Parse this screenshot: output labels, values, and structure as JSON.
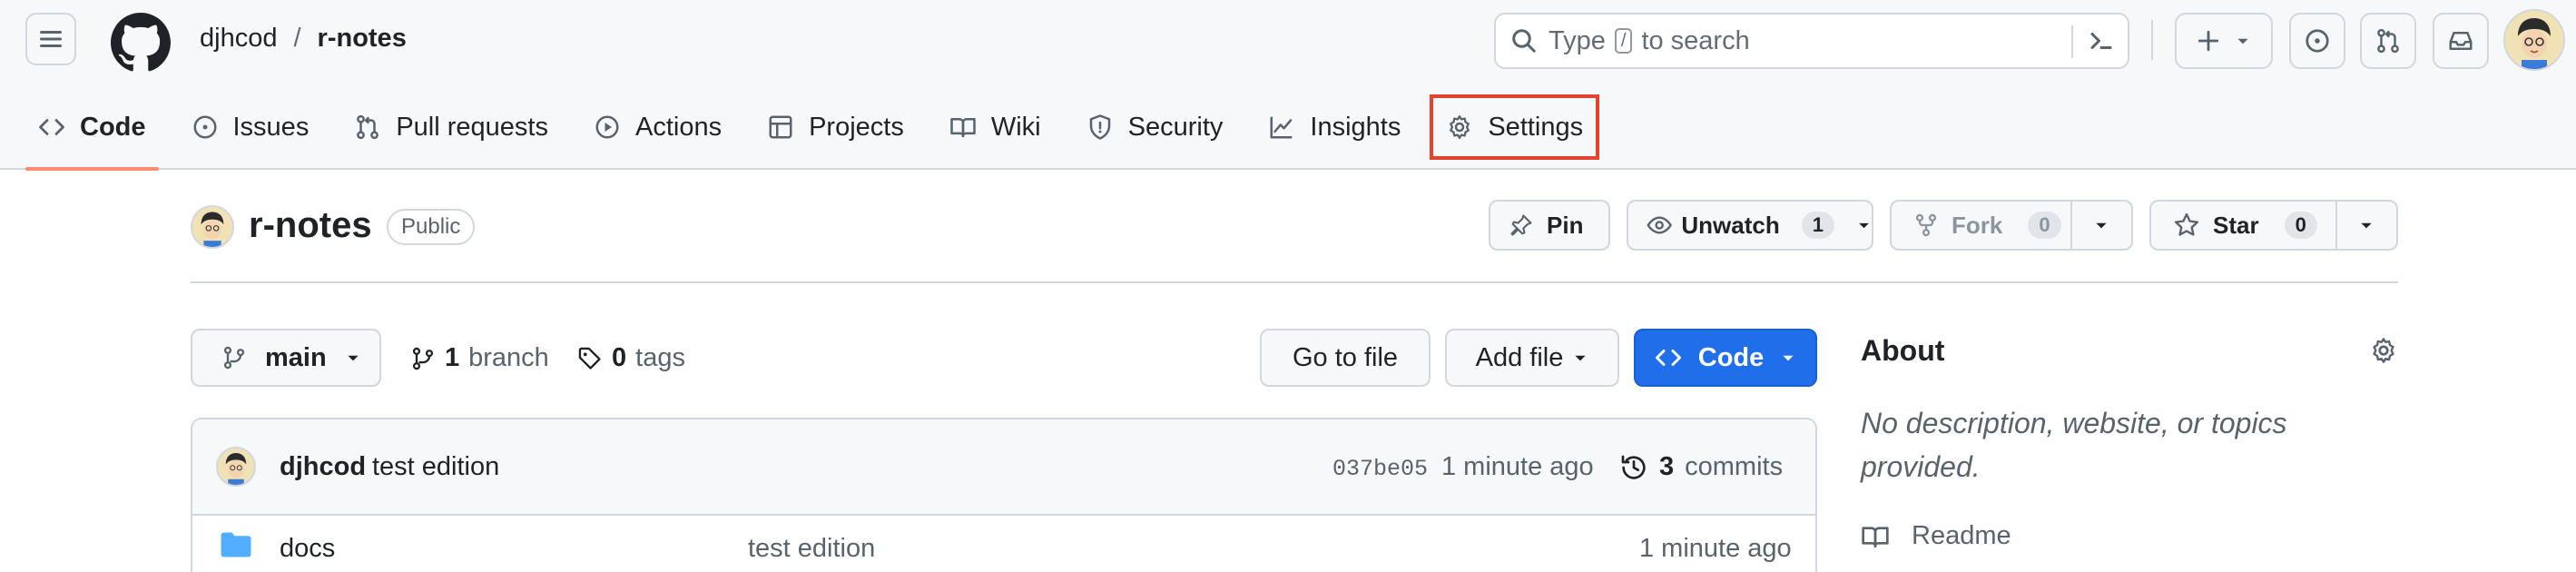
{
  "header": {
    "owner": "djhcod",
    "separator": "/",
    "repo": "r-notes",
    "search": {
      "before": "Type",
      "key": "/",
      "after": "to search"
    }
  },
  "nav": {
    "items": [
      {
        "label": "Code"
      },
      {
        "label": "Issues"
      },
      {
        "label": "Pull requests"
      },
      {
        "label": "Actions"
      },
      {
        "label": "Projects"
      },
      {
        "label": "Wiki"
      },
      {
        "label": "Security"
      },
      {
        "label": "Insights"
      },
      {
        "label": "Settings"
      }
    ],
    "active": "Code",
    "highlighted": "Settings",
    "active_underline_color": "#fd8c73",
    "highlight_color": "#e5432f"
  },
  "repo": {
    "title": "r-notes",
    "visibility": "Public",
    "pin_label": "Pin",
    "watch_label": "Unwatch",
    "watch_count": "1",
    "fork_label": "Fork",
    "fork_count": "0",
    "star_label": "Star",
    "star_count": "0"
  },
  "toolbar": {
    "branch": "main",
    "branch_count": "1",
    "branch_word": "branch",
    "tag_count": "0",
    "tag_word": "tags",
    "goto_label": "Go to file",
    "addfile_label": "Add file",
    "code_label": "Code",
    "code_button_color": "#1f6feb"
  },
  "commit": {
    "author": "djhcod",
    "message": "test edition",
    "sha": "037be05",
    "time": "1 minute ago",
    "count": "3",
    "count_word": "commits"
  },
  "files": [
    {
      "name": "docs",
      "message": "test edition",
      "time": "1 minute ago",
      "icon": "folder-icon"
    }
  ],
  "about": {
    "title": "About",
    "description": "No description, website, or topics provided.",
    "readme_label": "Readme"
  }
}
